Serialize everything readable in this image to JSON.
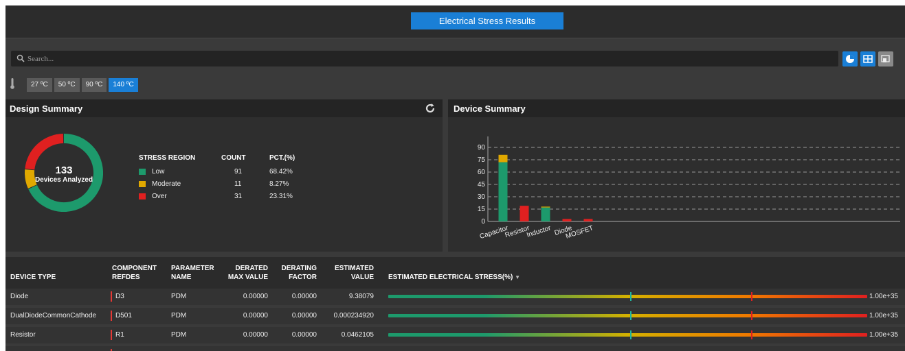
{
  "header": {
    "title": "Electrical Stress Results"
  },
  "search": {
    "placeholder": "Search..."
  },
  "toolbar": {
    "icons": [
      "pie-chart-icon",
      "table-icon",
      "export-icon"
    ]
  },
  "temperatures": {
    "options": [
      "27 ºC",
      "50 ºC",
      "90 ºC",
      "140 ºC"
    ],
    "selected": "140 ºC"
  },
  "design_summary": {
    "title": "Design Summary",
    "count": "133",
    "count_label": "Devices Analyzed",
    "headers": {
      "region": "STRESS REGION",
      "count": "COUNT",
      "pct": "PCT.(%)"
    },
    "rows": [
      {
        "region": "Low",
        "count": "91",
        "pct": "68.42%",
        "color": "#1d9a6c"
      },
      {
        "region": "Moderate",
        "count": "11",
        "pct": "8.27%",
        "color": "#e0a800"
      },
      {
        "region": "Over",
        "count": "31",
        "pct": "23.31%",
        "color": "#e02020"
      }
    ]
  },
  "device_summary": {
    "title": "Device Summary",
    "chart_data": {
      "type": "bar",
      "stacked": true,
      "categories": [
        "Capacitor",
        "Resistor",
        "Inductor",
        "Diode",
        "MOSFET"
      ],
      "series": [
        {
          "values": [
            72,
            0,
            17,
            0,
            0
          ],
          "color": "#1d9a6c"
        },
        {
          "values": [
            9,
            0,
            1,
            0,
            0
          ],
          "color": "#e0a800"
        },
        {
          "values": [
            0,
            19,
            0,
            3,
            3
          ],
          "color": "#e02020"
        }
      ],
      "yticks": [
        0,
        15,
        30,
        45,
        60,
        75,
        90
      ],
      "ylim": [
        0,
        100
      ],
      "grid": true
    }
  },
  "table": {
    "headers": {
      "device_type": "DEVICE TYPE",
      "component_1": "COMPONENT",
      "component_2": "REFDES",
      "parameter_1": "PARAMETER",
      "parameter_2": "NAME",
      "derated_1": "DERATED",
      "derated_2": "MAX VALUE",
      "derating_1": "DERATING",
      "derating_2": "FACTOR",
      "estimated_1": "ESTIMATED",
      "estimated_2": "VALUE",
      "stress": "ESTIMATED ELECTRICAL STRESS(%)"
    },
    "rows": [
      {
        "device_type": "Diode",
        "refdes": "D3",
        "param": "PDM",
        "derated_max": "0.00000",
        "factor": "0.00000",
        "estimated": "9.38079",
        "stress": "1.00e+35"
      },
      {
        "device_type": "DualDiodeCommonCathode",
        "refdes": "D501",
        "param": "PDM",
        "derated_max": "0.00000",
        "factor": "0.00000",
        "estimated": "0.000234920",
        "stress": "1.00e+35"
      },
      {
        "device_type": "Resistor",
        "refdes": "R1",
        "param": "PDM",
        "derated_max": "0.00000",
        "factor": "0.00000",
        "estimated": "0.0462105",
        "stress": "1.00e+35"
      }
    ]
  }
}
